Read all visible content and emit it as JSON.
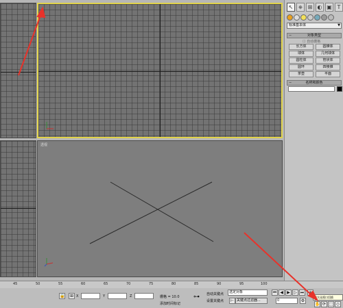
{
  "viewports": {
    "top_label": "",
    "perspective_label": "透视"
  },
  "panel": {
    "toolbar_icons": [
      "cursor-icon",
      "modify-icon",
      "hierarchy-icon",
      "motion-icon",
      "display-icon",
      "utilities-icon"
    ],
    "category_dropdown": "标准基本体",
    "object_type_title": "对象类型",
    "autogrid_label": "自动栅格",
    "object_buttons": [
      "长方体",
      "圆锥体",
      "球体",
      "几何球体",
      "圆柱体",
      "管状体",
      "圆环",
      "四棱锥",
      "茶壶",
      "平面"
    ],
    "name_color_title": "名称和颜色",
    "name_value": "",
    "color": "#000000"
  },
  "timeline": {
    "ticks": [
      "45",
      "50",
      "55",
      "60",
      "65",
      "70",
      "75",
      "80",
      "85",
      "90",
      "95",
      "100"
    ]
  },
  "status": {
    "x_label": "X",
    "y_label": "Y",
    "z_label": "Z",
    "grid_label": "栅格 = 10.0",
    "add_time_tag": "添加时间标记",
    "auto_key": "自动关键点",
    "set_key": "设置关键点",
    "selected_object": "选定对象",
    "key_filters": "关键点过滤器...",
    "frame_value": "0",
    "nav_tooltip": "最大化视口切换"
  },
  "colors": {
    "active_viewport": "#e1d34a",
    "annotation_arrow": "#e8322a",
    "background": "#737373"
  }
}
